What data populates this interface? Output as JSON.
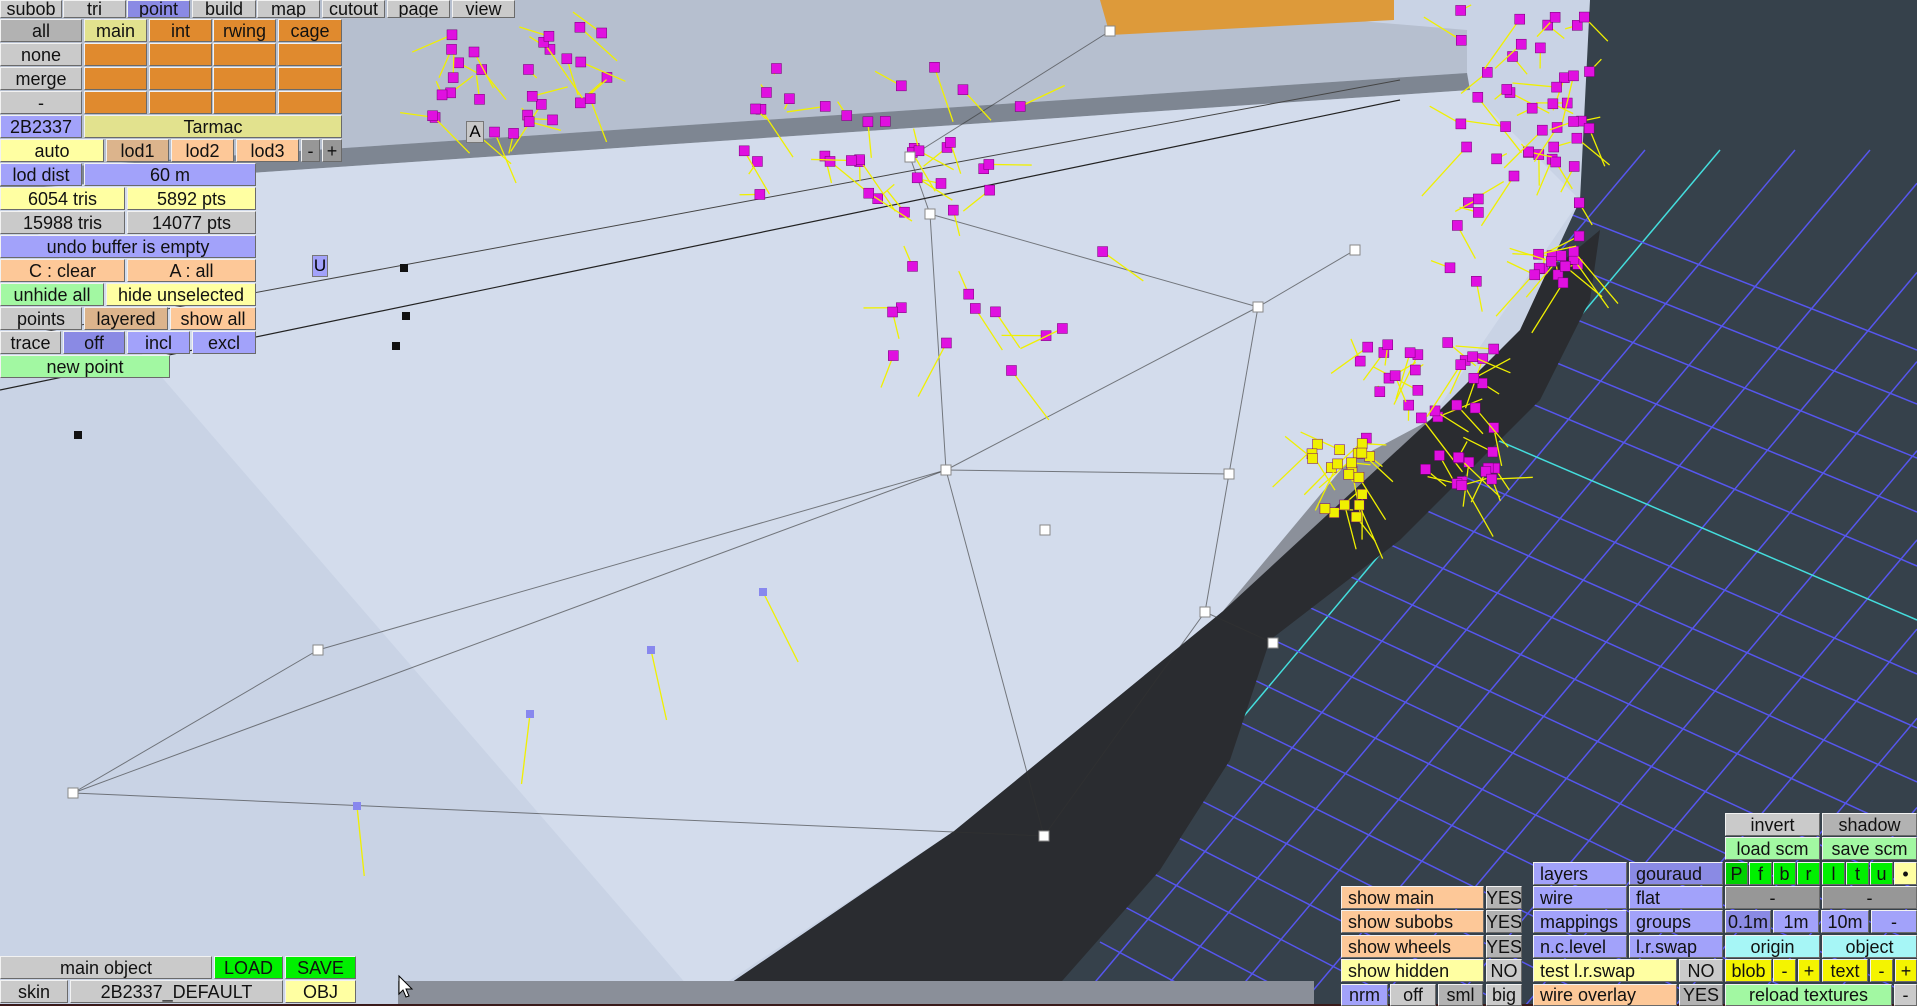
{
  "tabs": [
    "subob",
    "tri",
    "point",
    "build",
    "map",
    "cutout",
    "page",
    "view"
  ],
  "layers_grid": {
    "row_labels": [
      "all",
      "none",
      "merge",
      "-"
    ],
    "headers": [
      "main",
      "int",
      "rwing",
      "cage"
    ]
  },
  "object": {
    "id": "2B2337",
    "surface": "Tarmac"
  },
  "lod": {
    "auto": "auto",
    "levels": [
      "lod1",
      "lod2",
      "lod3"
    ],
    "minus": "-",
    "plus": "+",
    "dist_label": "lod dist",
    "dist_value": "60 m"
  },
  "stats": {
    "sel_tris": "6054 tris",
    "sel_pts": "5892 pts",
    "total_tris": "15988 tris",
    "total_pts": "14077 pts"
  },
  "undo_status": "undo buffer is empty",
  "select": {
    "clear": "C : clear",
    "all": "A : all"
  },
  "hide": {
    "unhide_all": "unhide all",
    "hide_unselected": "hide unselected"
  },
  "points": {
    "label": "points",
    "layered": "layered",
    "show_all": "show all"
  },
  "trace": {
    "label": "trace",
    "off": "off",
    "incl": "incl",
    "excl": "excl"
  },
  "new_point": "new point",
  "scene_labels": {
    "a": "A",
    "u": "U"
  },
  "bottom_left": {
    "main_object": "main object",
    "load": "LOAD",
    "save": "SAVE",
    "skin": "skin",
    "skin_value": "2B2337_DEFAULT",
    "obj": "OBJ"
  },
  "view_panel": {
    "invert": "invert",
    "shadow": "shadow",
    "load_scm": "load scm",
    "save_scm": "save scm",
    "view_dirs": [
      "P",
      "f",
      "b",
      "r",
      "l",
      "t",
      "u",
      "•"
    ],
    "dash": "-",
    "grid_sizes": [
      "0.1m",
      "1m",
      "10m",
      "-"
    ],
    "origin": "origin",
    "object": "object",
    "blob": "blob",
    "text": "text",
    "minus": "-",
    "plus": "+",
    "reload_textures": "reload textures",
    "render": {
      "layers": "layers",
      "gouraud": "gouraud",
      "wire": "wire",
      "flat": "flat",
      "mappings": "mappings",
      "groups": "groups",
      "nclevel": "n.c.level",
      "lrswap": "l.r.swap",
      "test_lrswap": "test l.r.swap",
      "test_lrswap_value": "NO",
      "wire_overlay": "wire overlay",
      "wire_overlay_value": "YES"
    },
    "show": [
      {
        "label": "show main",
        "value": "YES"
      },
      {
        "label": "show subobs",
        "value": "YES"
      },
      {
        "label": "show wheels",
        "value": "YES"
      },
      {
        "label": "show hidden",
        "value": "NO"
      }
    ],
    "normals": [
      "nrm",
      "off",
      "sml",
      "big"
    ]
  }
}
